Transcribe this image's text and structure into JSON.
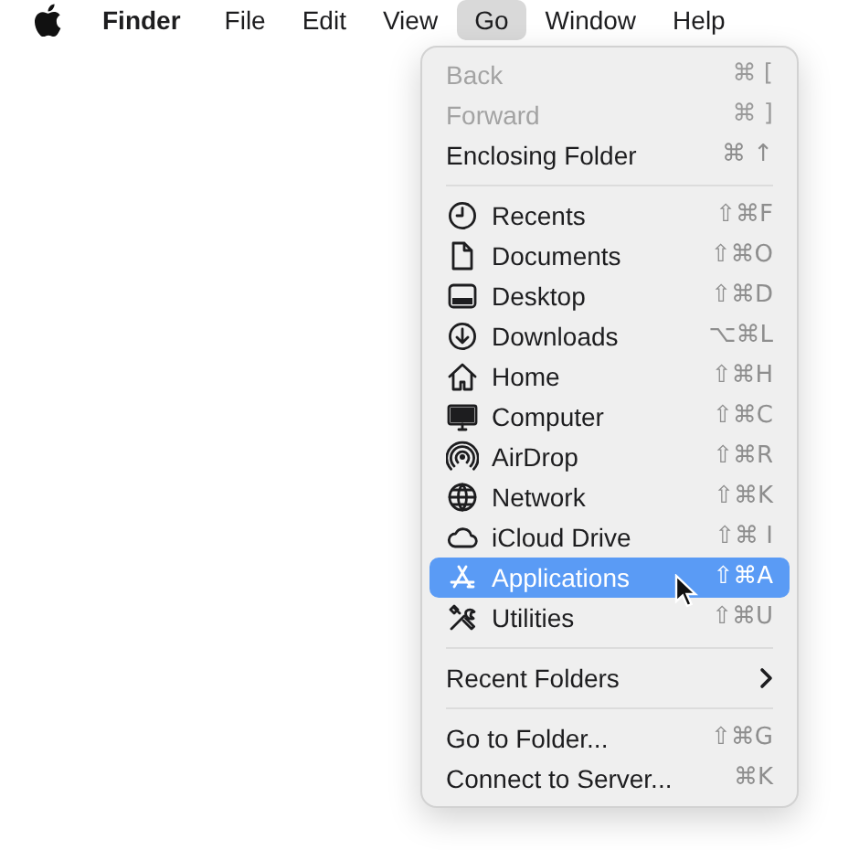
{
  "menu_bar": {
    "items": [
      {
        "kind": "apple",
        "selected": false
      },
      {
        "kind": "app",
        "label": "Finder",
        "selected": false
      },
      {
        "kind": "menu",
        "label": "File",
        "selected": false
      },
      {
        "kind": "menu",
        "label": "Edit",
        "selected": false
      },
      {
        "kind": "menu",
        "label": "View",
        "selected": false
      },
      {
        "kind": "menu",
        "label": "Go",
        "selected": true
      },
      {
        "kind": "menu",
        "label": "Window",
        "selected": false
      },
      {
        "kind": "menu",
        "label": "Help",
        "selected": false
      }
    ]
  },
  "go_menu": {
    "groups": [
      {
        "items": [
          {
            "label": "Back",
            "shortcut": "⌘ [",
            "disabled": true,
            "selected": false
          },
          {
            "label": "Forward",
            "shortcut": "⌘ ]",
            "disabled": true,
            "selected": false
          },
          {
            "label": "Enclosing Folder",
            "shortcut": "⌘ ↑",
            "disabled": false,
            "selected": false
          }
        ]
      },
      {
        "items": [
          {
            "label": "Recents",
            "shortcut": "⇧⌘F",
            "disabled": false,
            "selected": false
          },
          {
            "label": "Documents",
            "shortcut": "⇧⌘O",
            "disabled": false,
            "selected": false
          },
          {
            "label": "Desktop",
            "shortcut": "⇧⌘D",
            "disabled": false,
            "selected": false
          },
          {
            "label": "Downloads",
            "shortcut": "⌥⌘L",
            "disabled": false,
            "selected": false
          },
          {
            "label": "Home",
            "shortcut": "⇧⌘H",
            "disabled": false,
            "selected": false
          },
          {
            "label": "Computer",
            "shortcut": "⇧⌘C",
            "disabled": false,
            "selected": false
          },
          {
            "label": "AirDrop",
            "shortcut": "⇧⌘R",
            "disabled": false,
            "selected": false
          },
          {
            "label": "Network",
            "shortcut": "⇧⌘K",
            "disabled": false,
            "selected": false
          },
          {
            "label": "iCloud Drive",
            "shortcut": "⇧⌘ I",
            "disabled": false,
            "selected": false
          },
          {
            "label": "Applications",
            "shortcut": "⇧⌘A",
            "disabled": false,
            "selected": true
          },
          {
            "label": "Utilities",
            "shortcut": "⇧⌘U",
            "disabled": false,
            "selected": false
          }
        ]
      },
      {
        "items": [
          {
            "label": "Recent Folders",
            "kind": "submenu",
            "disabled": false,
            "selected": false
          }
        ]
      },
      {
        "items": [
          {
            "label": "Go to Folder...",
            "shortcut": "⇧⌘G",
            "disabled": false,
            "selected": false
          },
          {
            "label": "Connect to Server...",
            "shortcut": "⌘K",
            "disabled": false,
            "selected": false
          }
        ]
      }
    ]
  }
}
